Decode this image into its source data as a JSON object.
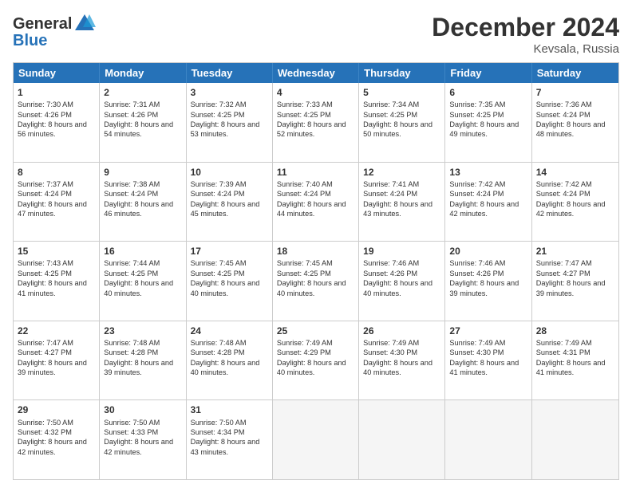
{
  "header": {
    "logo_line1": "General",
    "logo_line2": "Blue",
    "month": "December 2024",
    "location": "Kevsala, Russia"
  },
  "days_of_week": [
    "Sunday",
    "Monday",
    "Tuesday",
    "Wednesday",
    "Thursday",
    "Friday",
    "Saturday"
  ],
  "weeks": [
    [
      {
        "day": "1",
        "sunrise": "Sunrise: 7:30 AM",
        "sunset": "Sunset: 4:26 PM",
        "daylight": "Daylight: 8 hours and 56 minutes."
      },
      {
        "day": "2",
        "sunrise": "Sunrise: 7:31 AM",
        "sunset": "Sunset: 4:26 PM",
        "daylight": "Daylight: 8 hours and 54 minutes."
      },
      {
        "day": "3",
        "sunrise": "Sunrise: 7:32 AM",
        "sunset": "Sunset: 4:25 PM",
        "daylight": "Daylight: 8 hours and 53 minutes."
      },
      {
        "day": "4",
        "sunrise": "Sunrise: 7:33 AM",
        "sunset": "Sunset: 4:25 PM",
        "daylight": "Daylight: 8 hours and 52 minutes."
      },
      {
        "day": "5",
        "sunrise": "Sunrise: 7:34 AM",
        "sunset": "Sunset: 4:25 PM",
        "daylight": "Daylight: 8 hours and 50 minutes."
      },
      {
        "day": "6",
        "sunrise": "Sunrise: 7:35 AM",
        "sunset": "Sunset: 4:25 PM",
        "daylight": "Daylight: 8 hours and 49 minutes."
      },
      {
        "day": "7",
        "sunrise": "Sunrise: 7:36 AM",
        "sunset": "Sunset: 4:24 PM",
        "daylight": "Daylight: 8 hours and 48 minutes."
      }
    ],
    [
      {
        "day": "8",
        "sunrise": "Sunrise: 7:37 AM",
        "sunset": "Sunset: 4:24 PM",
        "daylight": "Daylight: 8 hours and 47 minutes."
      },
      {
        "day": "9",
        "sunrise": "Sunrise: 7:38 AM",
        "sunset": "Sunset: 4:24 PM",
        "daylight": "Daylight: 8 hours and 46 minutes."
      },
      {
        "day": "10",
        "sunrise": "Sunrise: 7:39 AM",
        "sunset": "Sunset: 4:24 PM",
        "daylight": "Daylight: 8 hours and 45 minutes."
      },
      {
        "day": "11",
        "sunrise": "Sunrise: 7:40 AM",
        "sunset": "Sunset: 4:24 PM",
        "daylight": "Daylight: 8 hours and 44 minutes."
      },
      {
        "day": "12",
        "sunrise": "Sunrise: 7:41 AM",
        "sunset": "Sunset: 4:24 PM",
        "daylight": "Daylight: 8 hours and 43 minutes."
      },
      {
        "day": "13",
        "sunrise": "Sunrise: 7:42 AM",
        "sunset": "Sunset: 4:24 PM",
        "daylight": "Daylight: 8 hours and 42 minutes."
      },
      {
        "day": "14",
        "sunrise": "Sunrise: 7:42 AM",
        "sunset": "Sunset: 4:24 PM",
        "daylight": "Daylight: 8 hours and 42 minutes."
      }
    ],
    [
      {
        "day": "15",
        "sunrise": "Sunrise: 7:43 AM",
        "sunset": "Sunset: 4:25 PM",
        "daylight": "Daylight: 8 hours and 41 minutes."
      },
      {
        "day": "16",
        "sunrise": "Sunrise: 7:44 AM",
        "sunset": "Sunset: 4:25 PM",
        "daylight": "Daylight: 8 hours and 40 minutes."
      },
      {
        "day": "17",
        "sunrise": "Sunrise: 7:45 AM",
        "sunset": "Sunset: 4:25 PM",
        "daylight": "Daylight: 8 hours and 40 minutes."
      },
      {
        "day": "18",
        "sunrise": "Sunrise: 7:45 AM",
        "sunset": "Sunset: 4:25 PM",
        "daylight": "Daylight: 8 hours and 40 minutes."
      },
      {
        "day": "19",
        "sunrise": "Sunrise: 7:46 AM",
        "sunset": "Sunset: 4:26 PM",
        "daylight": "Daylight: 8 hours and 40 minutes."
      },
      {
        "day": "20",
        "sunrise": "Sunrise: 7:46 AM",
        "sunset": "Sunset: 4:26 PM",
        "daylight": "Daylight: 8 hours and 39 minutes."
      },
      {
        "day": "21",
        "sunrise": "Sunrise: 7:47 AM",
        "sunset": "Sunset: 4:27 PM",
        "daylight": "Daylight: 8 hours and 39 minutes."
      }
    ],
    [
      {
        "day": "22",
        "sunrise": "Sunrise: 7:47 AM",
        "sunset": "Sunset: 4:27 PM",
        "daylight": "Daylight: 8 hours and 39 minutes."
      },
      {
        "day": "23",
        "sunrise": "Sunrise: 7:48 AM",
        "sunset": "Sunset: 4:28 PM",
        "daylight": "Daylight: 8 hours and 39 minutes."
      },
      {
        "day": "24",
        "sunrise": "Sunrise: 7:48 AM",
        "sunset": "Sunset: 4:28 PM",
        "daylight": "Daylight: 8 hours and 40 minutes."
      },
      {
        "day": "25",
        "sunrise": "Sunrise: 7:49 AM",
        "sunset": "Sunset: 4:29 PM",
        "daylight": "Daylight: 8 hours and 40 minutes."
      },
      {
        "day": "26",
        "sunrise": "Sunrise: 7:49 AM",
        "sunset": "Sunset: 4:30 PM",
        "daylight": "Daylight: 8 hours and 40 minutes."
      },
      {
        "day": "27",
        "sunrise": "Sunrise: 7:49 AM",
        "sunset": "Sunset: 4:30 PM",
        "daylight": "Daylight: 8 hours and 41 minutes."
      },
      {
        "day": "28",
        "sunrise": "Sunrise: 7:49 AM",
        "sunset": "Sunset: 4:31 PM",
        "daylight": "Daylight: 8 hours and 41 minutes."
      }
    ],
    [
      {
        "day": "29",
        "sunrise": "Sunrise: 7:50 AM",
        "sunset": "Sunset: 4:32 PM",
        "daylight": "Daylight: 8 hours and 42 minutes."
      },
      {
        "day": "30",
        "sunrise": "Sunrise: 7:50 AM",
        "sunset": "Sunset: 4:33 PM",
        "daylight": "Daylight: 8 hours and 42 minutes."
      },
      {
        "day": "31",
        "sunrise": "Sunrise: 7:50 AM",
        "sunset": "Sunset: 4:34 PM",
        "daylight": "Daylight: 8 hours and 43 minutes."
      },
      null,
      null,
      null,
      null
    ]
  ]
}
